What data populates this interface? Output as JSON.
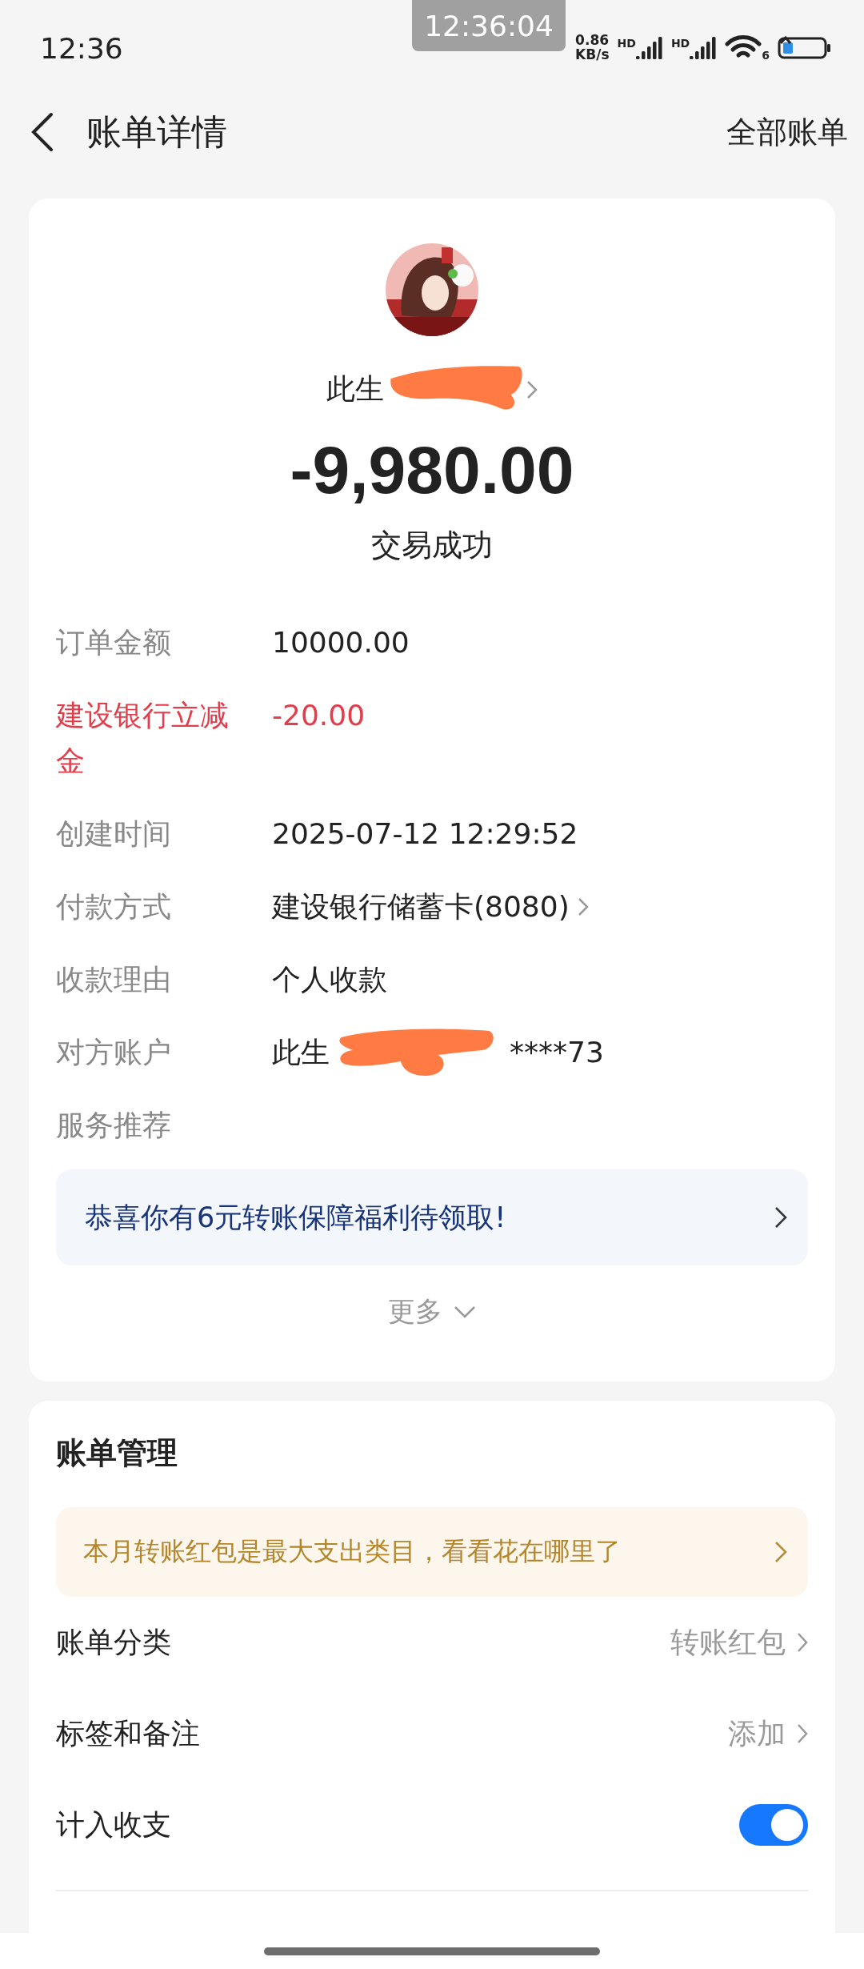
{
  "status_bar": {
    "time": "12:36",
    "overlay_clock": "12:36:04",
    "net_speed": [
      "0.86",
      "KB/s"
    ],
    "signals": [
      {
        "label": "HD"
      },
      {
        "label": "HD"
      }
    ],
    "wifi_label": "6"
  },
  "header": {
    "title": "账单详情",
    "action": "全部账单"
  },
  "payee": {
    "name": "此生",
    "redacted": true
  },
  "amount": "-9,980.00",
  "status": "交易成功",
  "details": [
    {
      "kind": "plain",
      "label": "订单金额",
      "value": "10000.00"
    },
    {
      "kind": "discount",
      "label": "建设银行立减金",
      "value": "-20.00"
    },
    {
      "kind": "plain",
      "label": "创建时间",
      "value": "2025-07-12 12:29:52"
    },
    {
      "kind": "link",
      "label": "付款方式",
      "value": "建设银行储蓄卡(8080)"
    },
    {
      "kind": "plain",
      "label": "收款理由",
      "value": "个人收款"
    },
    {
      "kind": "redacted",
      "label": "对方账户",
      "value": "此生",
      "value_end": "****73"
    },
    {
      "kind": "heading",
      "label": "服务推荐"
    }
  ],
  "service_banner": "恭喜你有6元转账保障福利待领取!",
  "more": "更多",
  "management": {
    "title": "账单管理",
    "tip": "本月转账红包是最大支出类目，看看花在哪里了",
    "rows": [
      {
        "kind": "link",
        "label": "账单分类",
        "value": "转账红包"
      },
      {
        "kind": "link",
        "label": "标签和备注",
        "value": "添加"
      },
      {
        "kind": "toggle",
        "label": "计入收支",
        "on": true
      }
    ]
  }
}
